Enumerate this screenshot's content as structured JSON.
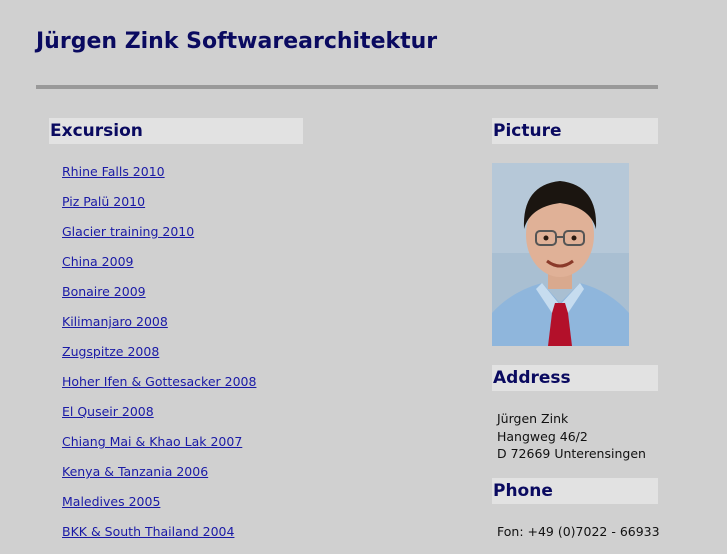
{
  "site": {
    "title": "Jürgen Zink Softwarearchitektur"
  },
  "excursion": {
    "heading": "Excursion",
    "links": [
      "Rhine Falls 2010",
      "Piz Palü 2010",
      "Glacier training 2010",
      "China 2009",
      "Bonaire 2009",
      "Kilimanjaro 2008",
      "Zugspitze 2008",
      "Hoher Ifen & Gottesacker 2008",
      "El Quseir 2008",
      "Chiang Mai & Khao Lak 2007",
      "Kenya & Tanzania 2006",
      "Maledives 2005",
      "BKK & South Thailand 2004"
    ]
  },
  "picture": {
    "heading": "Picture"
  },
  "address": {
    "heading": "Address",
    "name": "Jürgen Zink",
    "street": "Hangweg 46/2",
    "city": "D 72669 Unterensingen"
  },
  "phone": {
    "heading": "Phone",
    "fon": "Fon: +49 (0)7022 - 66933"
  },
  "colors": {
    "background": "#d0d0d0",
    "heading_text": "#0a0a60",
    "heading_bg": "#e2e2e2",
    "link": "#1a1aa6",
    "rule": "#999999"
  }
}
